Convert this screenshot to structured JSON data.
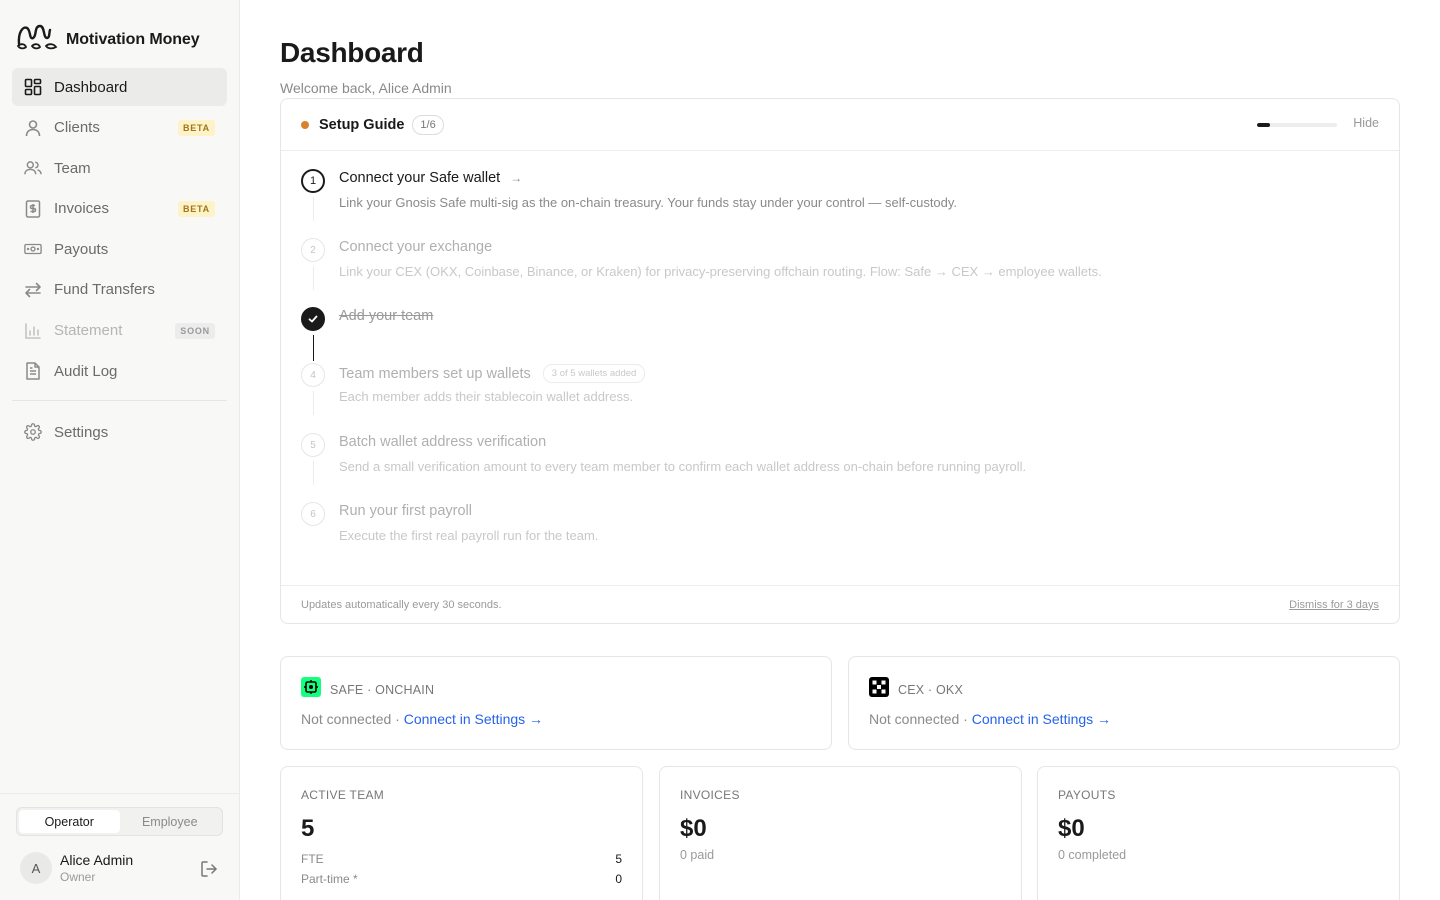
{
  "brand": {
    "name": "Motivation Money"
  },
  "sidebar": {
    "items": [
      {
        "label": "Dashboard",
        "icon": "dashboard-grid-icon",
        "active": true
      },
      {
        "label": "Clients",
        "icon": "user-icon",
        "badge": "BETA"
      },
      {
        "label": "Team",
        "icon": "users-icon"
      },
      {
        "label": "Invoices",
        "icon": "invoice-dollar-icon",
        "badge": "BETA"
      },
      {
        "label": "Payouts",
        "icon": "banknote-icon"
      },
      {
        "label": "Fund Transfers",
        "icon": "transfer-arrows-icon"
      },
      {
        "label": "Statement",
        "icon": "bar-chart-icon",
        "badge": "SOON",
        "disabled": true
      },
      {
        "label": "Audit Log",
        "icon": "document-icon"
      }
    ],
    "settings": {
      "label": "Settings",
      "icon": "gear-icon"
    },
    "role_toggle": {
      "options": [
        "Operator",
        "Employee"
      ],
      "selected": "Operator"
    },
    "user": {
      "initial": "A",
      "name": "Alice Admin",
      "role": "Owner"
    }
  },
  "header": {
    "title": "Dashboard",
    "welcome": "Welcome back, Alice Admin"
  },
  "setup_guide": {
    "title": "Setup Guide",
    "count": "1/6",
    "progress": 0.167,
    "hide_label": "Hide",
    "steps": [
      {
        "num": "1",
        "title": "Connect your Safe wallet",
        "desc": "Link your Gnosis Safe multi-sig as the on-chain treasury. Your funds stay under your control — self-custody.",
        "state": "current",
        "arrow": "→"
      },
      {
        "num": "2",
        "title": "Connect your exchange",
        "desc": "Link your CEX (OKX, Coinbase, Binance, or Kraken) for privacy-preserving offchain routing. Flow: Safe → CEX → employee wallets.",
        "state": "pending"
      },
      {
        "num": "3",
        "title": "Add your team",
        "desc": "",
        "state": "done"
      },
      {
        "num": "4",
        "title": "Team members set up wallets",
        "pill": "3 of 5 wallets added",
        "desc": "Each member adds their stablecoin wallet address.",
        "state": "pending"
      },
      {
        "num": "5",
        "title": "Batch wallet address verification",
        "desc": "Send a small verification amount to every team member to confirm each wallet address on-chain before running payroll.",
        "state": "pending"
      },
      {
        "num": "6",
        "title": "Run your first payroll",
        "desc": "Execute the first real payroll run for the team.",
        "state": "pending"
      }
    ],
    "footer_note": "Updates automatically every 30 seconds.",
    "dismiss_label": "Dismiss for 3 days"
  },
  "connections": [
    {
      "label": "SAFE · ONCHAIN",
      "status": "Not connected · ",
      "link": "Connect in Settings →",
      "icon_color": "#12ff80"
    },
    {
      "label": "CEX · OKX",
      "status": "Not connected · ",
      "link": "Connect in Settings →",
      "icon_color": "#000000"
    }
  ],
  "stats": {
    "team": {
      "label": "ACTIVE TEAM",
      "value": "5",
      "rows": [
        {
          "k": "FTE",
          "v": "5"
        },
        {
          "k": "Part-time *",
          "v": "0"
        }
      ]
    },
    "invoices": {
      "label": "INVOICES",
      "value": "$0",
      "sub": "0 paid"
    },
    "payouts": {
      "label": "PAYOUTS",
      "value": "$0",
      "sub": "0 completed"
    }
  },
  "colors": {
    "accent_link": "#2563eb",
    "setup_dot": "#d9822b",
    "beta_bg": "#fdf2c8",
    "beta_text": "#a0761a"
  }
}
